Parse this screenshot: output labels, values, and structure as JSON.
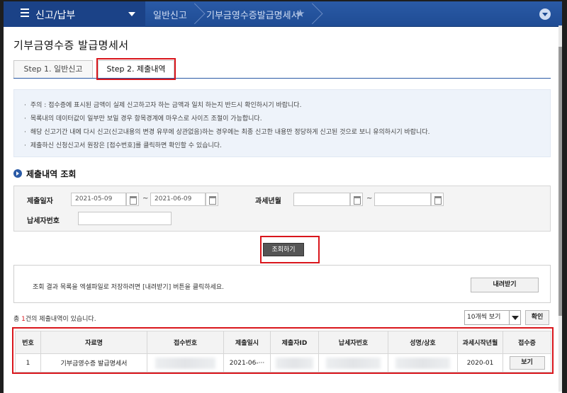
{
  "nav": {
    "menu_label": "신고/납부",
    "crumbs": [
      "일반신고",
      "기부금영수증발급명세서"
    ]
  },
  "page": {
    "title": "기부금영수증 발급명세서"
  },
  "tabs": [
    {
      "label": "Step 1. 일반신고"
    },
    {
      "label": "Step 2. 제출내역"
    }
  ],
  "notices": [
    "주의 : 접수증에 표시된 금액이 실제 신고하고자 하는 금액과 일치 하는지 반드시 확인하시기 바랍니다.",
    "목록내의 데이터값이 일부만 보일 경우 항목경계에 마우스로 사이즈 조절이 가능합니다.",
    "해당 신고기간 내에 다시 신고(신고내용의 변경 유무에 상관없음)하는 경우에는 최종 신고한 내용만 정당하게 신고된 것으로 보니 유의하시기 바랍니다.",
    "제출하신 신청신고서 원장은 [접수번호]를 클릭하면 확인할 수 있습니다."
  ],
  "section": {
    "title": "제출내역 조회"
  },
  "form": {
    "submit_date_label": "제출일자",
    "date_from": "2021-05-09",
    "date_to": "2021-06-09",
    "tax_month_label": "과세년월",
    "tax_from": "",
    "tax_to": "",
    "taxpayer_label": "납세자번호",
    "taxpayer_value": "",
    "tilde": "~",
    "search_button": "조회하기"
  },
  "download": {
    "text": "조회 결과 목록을 엑셀파일로 저장하려면 [내려받기] 버튼을 클릭하세요.",
    "button": "내려받기"
  },
  "result": {
    "prefix": "총 ",
    "count": "1",
    "suffix": "건의 제출내역이 있습니다.",
    "page_size": "10개씩 보기",
    "confirm_button": "확인"
  },
  "table": {
    "headers": [
      "번호",
      "자료명",
      "접수번호",
      "제출일시",
      "제출자ID",
      "납세자번호",
      "성명/상호",
      "과세시작년월",
      "접수증"
    ],
    "rows": [
      {
        "no": "1",
        "name": "기부금영수증 발급명세서",
        "receipt_no": "",
        "submitted": "2021-06-···",
        "submitter_id": "",
        "taxpayer_no": "",
        "person": "",
        "tax_start": "2020-01",
        "receipt_button": "보기"
      }
    ]
  },
  "colors": {
    "nav_bg": "#1f4c94",
    "accent": "#2a5aa6",
    "highlight": "#d9161c",
    "notice_bg": "#eef3fa"
  }
}
